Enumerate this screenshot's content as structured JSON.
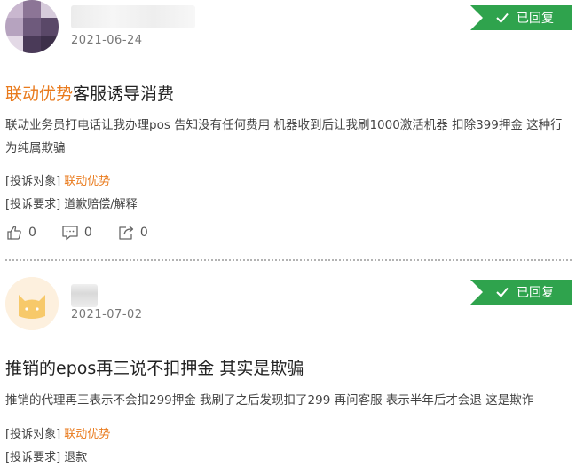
{
  "complaints": [
    {
      "date": "2021-06-24",
      "status": "已回复",
      "title_brand": "联动优势",
      "title_rest": "客服诱导消费",
      "content": "联动业务员打电话让我办理pos 告知没有任何费用 机器收到后让我刷1000激活机器 扣除399押金 这种行为纯属欺骗",
      "target_label": "[投诉对象]",
      "target_value": "联动优势",
      "request_label": "[投诉要求]",
      "request_value": "道歉赔偿/解释",
      "likes": "0",
      "comments": "0",
      "shares": "0",
      "avatar_icon": "pixelated-avatar-icon"
    },
    {
      "date": "2021-07-02",
      "status": "已回复",
      "title": "推销的epos再三说不扣押金 其实是欺骗",
      "content": "推销的代理再三表示不会扣299押金 我刷了之后发现扣了299 再问客服 表示半年后才会退 这是欺诈",
      "target_label": "[投诉对象]",
      "target_value": "联动优势",
      "request_label": "[投诉要求]",
      "request_value": "退款",
      "avatar_icon": "cat-avatar-icon"
    }
  ],
  "colors": {
    "brand_orange": "#e97a1c",
    "badge_green": "#2fa34d",
    "text": "#333333"
  }
}
